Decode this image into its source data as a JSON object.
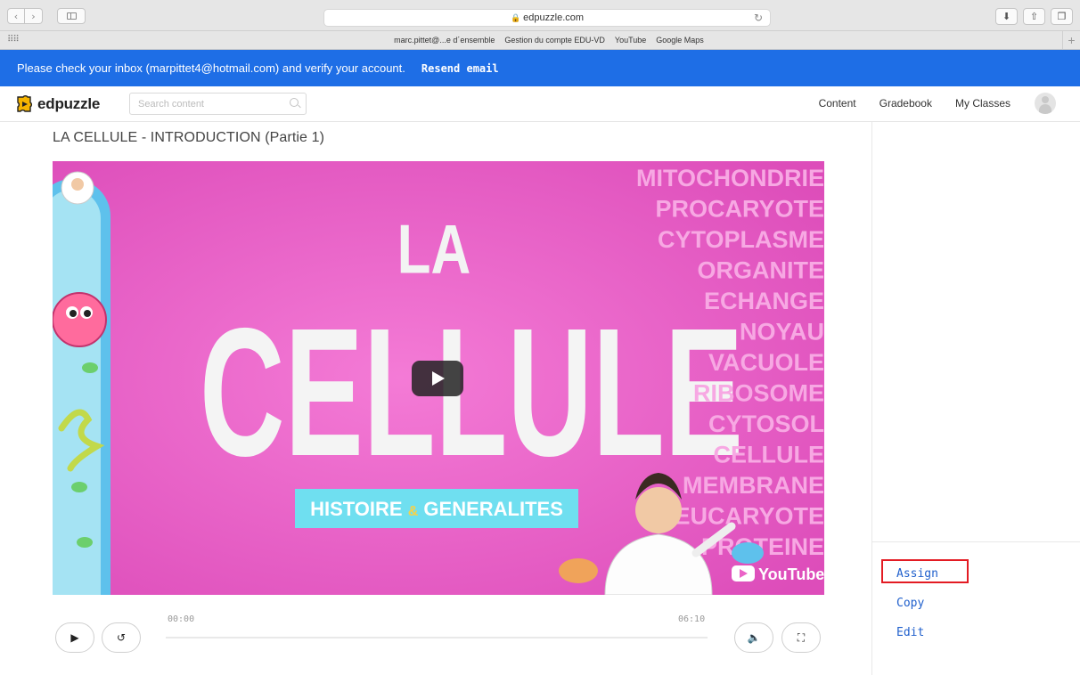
{
  "browser": {
    "url": "edpuzzle.com",
    "bookmarks": [
      "marc.pittet@...e d´ensemble",
      "Gestion du compte EDU-VD",
      "YouTube",
      "Google Maps"
    ]
  },
  "banner": {
    "message": "Please check your inbox (marpittet4@hotmail.com) and verify your account.",
    "resend_label": "Resend email",
    "color": "#1e6ee6"
  },
  "header": {
    "logo_text": "edpuzzle",
    "search_placeholder": "Search content",
    "nav": [
      "Content",
      "Gradebook",
      "My Classes"
    ]
  },
  "page": {
    "title": "LA CELLULE - INTRODUCTION (Partie 1)"
  },
  "video": {
    "thumb_title_small": "LA",
    "thumb_title_big": "CELLULE",
    "thumb_subtitle_a": "HISTOIRE",
    "thumb_subtitle_amp": "&",
    "thumb_subtitle_b": "GENERALITES",
    "word_list": [
      "MITOCHONDRIE",
      "PROCARYOTE",
      "CYTOPLASME",
      "ORGANITE",
      "ECHANGE",
      "NOYAU",
      "VACUOLE",
      "RIBOSOME",
      "CYTOSOL",
      "CELLULE",
      "MEMBRANE",
      "EUCARYOTE",
      "PROTEINE"
    ],
    "youtube_label": "YouTube"
  },
  "player": {
    "current_time": "00:00",
    "duration": "06:10",
    "progress": 0
  },
  "actions": {
    "assign": "Assign",
    "copy": "Copy",
    "edit": "Edit",
    "link_color": "#1f5fcc",
    "highlight_color": "#e31b23"
  }
}
